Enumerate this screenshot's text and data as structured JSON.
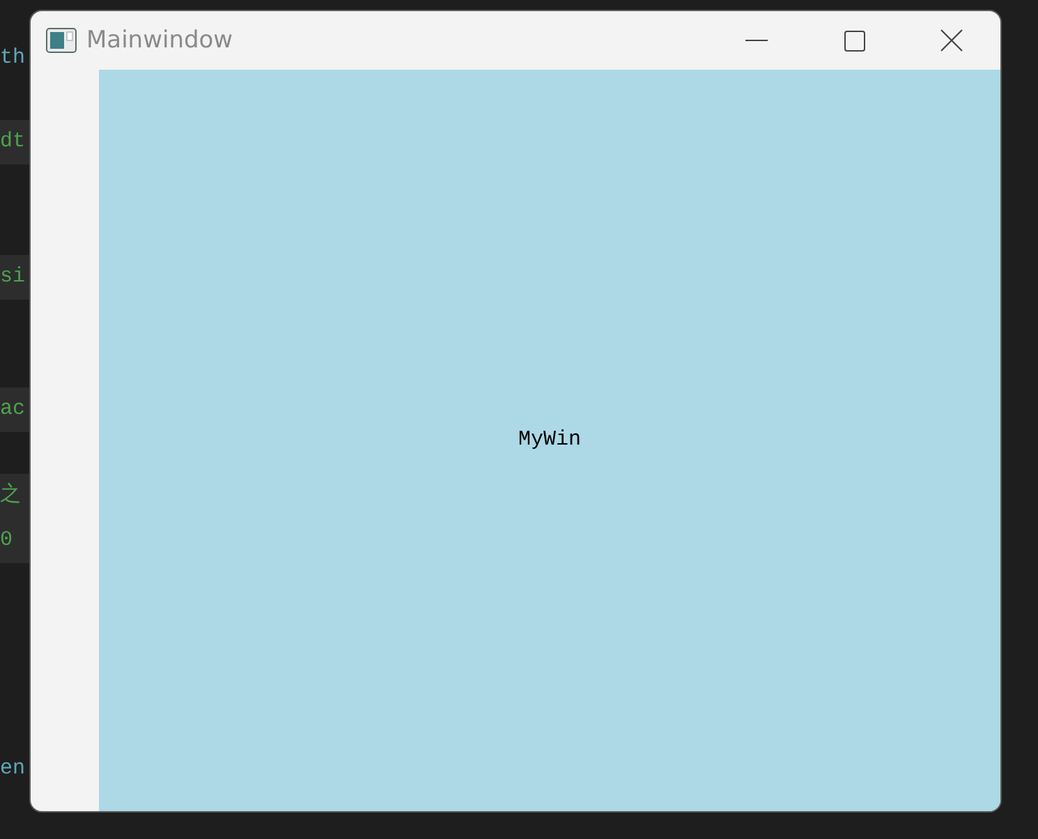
{
  "background_code": [
    {
      "text": "th",
      "kind": "code",
      "highlighted": false
    },
    {
      "text": "dt",
      "kind": "comment",
      "highlighted": true
    },
    {
      "text": "si",
      "kind": "comment",
      "highlighted": true
    },
    {
      "text": "ac",
      "kind": "comment",
      "highlighted": true
    },
    {
      "text": "之",
      "kind": "comment",
      "highlighted": true
    },
    {
      "text": "0",
      "kind": "comment",
      "highlighted": true
    },
    {
      "text": "en",
      "kind": "code",
      "highlighted": false
    }
  ],
  "window": {
    "title": "Mainwindow",
    "content_label": "MyWin"
  }
}
